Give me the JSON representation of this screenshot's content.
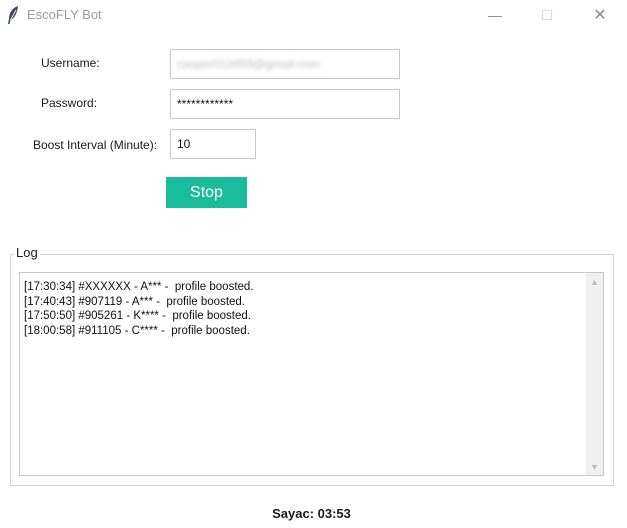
{
  "window": {
    "title": "EscoFLY Bot",
    "minimize_glyph": "—",
    "maximize_glyph": "☐",
    "close_glyph": "✕"
  },
  "form": {
    "username_label": "Username:",
    "username_value": "casper013459@gmail.com",
    "password_label": "Password:",
    "password_value": "************",
    "interval_label": "Boost Interval (Minute):",
    "interval_value": "10",
    "stop_label": "Stop"
  },
  "log": {
    "legend": "Log",
    "lines": [
      "[17:30:34] #XXXXXX - A*** -  profile boosted.",
      "[17:40:43] #907119 - A*** -  profile boosted.",
      "[17:50:50] #905261 - K**** -  profile boosted.",
      "[18:00:58] #911105 - C**** -  profile boosted."
    ]
  },
  "counter": "Sayac: 03:53",
  "colors": {
    "accent": "#1abc9c",
    "title_text": "#9a9a9a"
  },
  "icons": {
    "app": "feather-icon",
    "scroll_up": "▲",
    "scroll_down": "▼"
  }
}
